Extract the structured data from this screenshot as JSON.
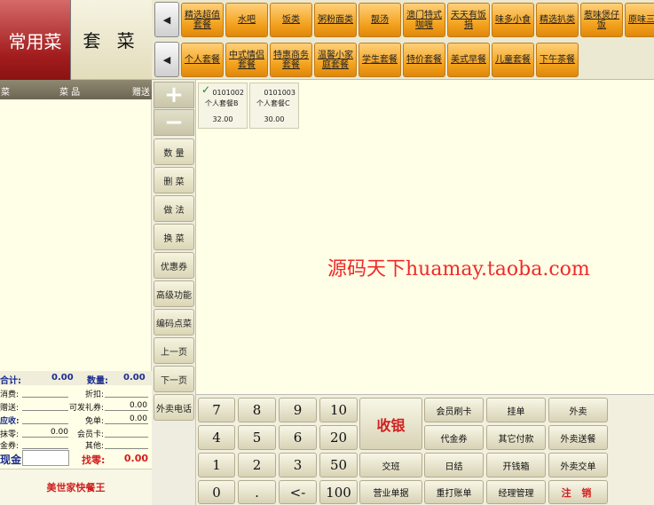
{
  "tabs": {
    "common": "常用菜",
    "set": "套 菜"
  },
  "order_header": {
    "col_left": "菜",
    "col_dish": "菜 品",
    "col_gift": "赠送"
  },
  "totals": {
    "total_label": "合计:",
    "total_value": "0.00",
    "qty_label": "数量:",
    "qty_value": "0.00"
  },
  "details": {
    "consume_label": "消费:",
    "discount_label": "折扣:",
    "gift_label": "赠送:",
    "voucher_label": "可发礼券:",
    "voucher_value": "0.00",
    "receivable_label": "应收:",
    "free_label": "免单:",
    "free_value": "0.00",
    "wipe_label": "抹零:",
    "wipe_value": "0.00",
    "member_label": "会员卡:",
    "coupon_label": "金券:",
    "other_label": "其他:",
    "cash_label": "现金:",
    "change_label": "找零:",
    "change_value": "0.00"
  },
  "brand": "美世家快餐王",
  "category_row1": [
    "精选超值套餐",
    "水吧",
    "饭类",
    "粥粉面类",
    "靓汤",
    "澳门特式咖喱",
    "天天有饭捐",
    "味多小食",
    "精选扒类",
    "惹味煲仔饭",
    "原味三治"
  ],
  "category_row2": [
    "个人套餐",
    "中式情侣套餐",
    "特惠商务套餐",
    "温馨小家庭套餐",
    "学生套餐",
    "特价套餐",
    "美式早餐",
    "儿童套餐",
    "下午茶餐"
  ],
  "side_buttons": {
    "plus": "+",
    "minus": "−",
    "quantity": "数 量",
    "delete": "删 菜",
    "method": "做 法",
    "swap": "换 菜",
    "coupon": "优惠券",
    "advanced": "高级功能",
    "code_order": "编码点菜",
    "prev_page": "上一页",
    "next_page": "下一页",
    "takeout_phone": "外卖电话"
  },
  "dishes": [
    {
      "code": "0101002",
      "name": "个人套餐B",
      "price": "32.00",
      "selected": true
    },
    {
      "code": "0101003",
      "name": "个人套餐C",
      "price": "30.00",
      "selected": false
    }
  ],
  "watermark": "源码天下huamay.taoba.com",
  "keypad": {
    "k7": "7",
    "k8": "8",
    "k9": "9",
    "k10": "10",
    "k4": "4",
    "k5": "5",
    "k6": "6",
    "k20": "20",
    "k1": "1",
    "k2": "2",
    "k3": "3",
    "k50": "50",
    "k0": "0",
    "kdot": ".",
    "kback": "<-",
    "k100": "100",
    "cashier": "收银",
    "handover": "交班",
    "sales_report": "营业单据",
    "member_card": "会员刷卡",
    "voucher": "代金券",
    "daily_close": "日结",
    "reprint": "重打账单",
    "hold": "挂单",
    "other_pay": "其它付款",
    "open_drawer": "开钱箱",
    "manager": "经理管理",
    "takeout": "外卖",
    "takeout_delivery": "外卖送餐",
    "takeout_order": "外卖交单",
    "logout": "注 销"
  }
}
